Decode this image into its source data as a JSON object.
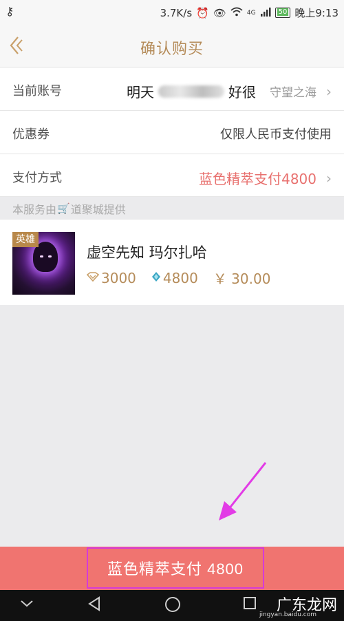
{
  "status_bar": {
    "speed": "3.7K/s",
    "network": "4G",
    "battery": "50",
    "time": "晚上9:13",
    "icons": [
      "key-icon",
      "alarm-icon",
      "eye-icon",
      "wifi-icon",
      "signal-icon",
      "battery-icon"
    ]
  },
  "header": {
    "title": "确认购买",
    "back_icon": "chevron-left-icon"
  },
  "account": {
    "label": "当前账号",
    "name_start": "明天",
    "name_end": "好很",
    "server": "守望之海"
  },
  "coupon": {
    "label": "优惠券",
    "value": "仅限人民币支付使用"
  },
  "payment": {
    "label": "支付方式",
    "value": "蓝色精萃支付4800"
  },
  "provider": {
    "prefix": "本服务由",
    "suffix": "道聚城提供"
  },
  "product": {
    "tag": "英雄",
    "name": "虚空先知 玛尔扎哈",
    "ip_price": "3000",
    "be_price": "4800",
    "rmb_price": "￥ 30.00"
  },
  "pay_button": {
    "label": "蓝色精萃支付 4800"
  },
  "nav": {
    "watermark": "广东龙网",
    "watermark_sub": "jingyan.baidu.com"
  },
  "colors": {
    "accent_gold": "#b58c5a",
    "pay_red": "#f07470",
    "highlight_magenta": "#d63ad8"
  }
}
